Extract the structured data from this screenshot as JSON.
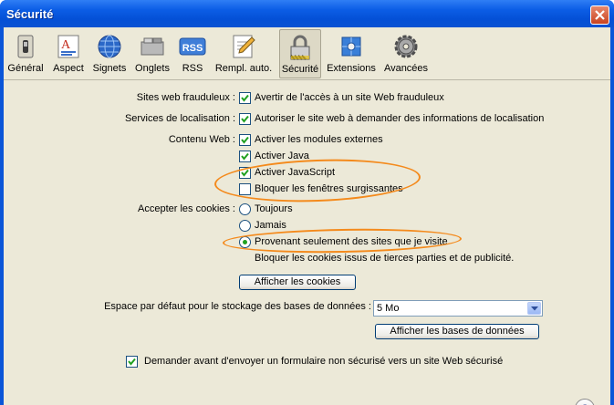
{
  "window": {
    "title": "Sécurité"
  },
  "toolbar": {
    "items": [
      {
        "label": "Général",
        "icon": "switch-icon"
      },
      {
        "label": "Aspect",
        "icon": "font-icon"
      },
      {
        "label": "Signets",
        "icon": "globe-icon"
      },
      {
        "label": "Onglets",
        "icon": "tabs-icon"
      },
      {
        "label": "RSS",
        "icon": "rss-icon"
      },
      {
        "label": "Rempl. auto.",
        "icon": "pencil-icon"
      },
      {
        "label": "Sécurité",
        "icon": "lock-icon",
        "selected": true
      },
      {
        "label": "Extensions",
        "icon": "puzzle-icon"
      },
      {
        "label": "Avancées",
        "icon": "gear-icon"
      }
    ]
  },
  "security": {
    "fraud_label": "Sites web frauduleux :",
    "fraud_option": "Avertir de l'accès à un site Web frauduleux",
    "location_label": "Services de localisation :",
    "location_option": "Autoriser le site web à demander des informations de localisation",
    "web_content_label": "Contenu Web :",
    "plugins_option": "Activer les modules externes",
    "java_option": "Activer Java",
    "javascript_option": "Activer JavaScript",
    "popups_option": "Bloquer les fenêtres surgissantes",
    "cookies_label": "Accepter les cookies :",
    "cookies_always": "Toujours",
    "cookies_never": "Jamais",
    "cookies_visited": "Provenant seulement des sites que je visite",
    "cookies_note": "Bloquer les cookies issus de tierces parties et de publicité.",
    "show_cookies_button": "Afficher les cookies",
    "storage_label": "Espace par défaut pour le stockage des bases de données :",
    "storage_value": "5 Mo",
    "show_databases_button": "Afficher les bases de données",
    "insecure_form_option": "Demander avant d'envoyer un formulaire non sécurisé vers un site Web sécurisé",
    "help_label": "?"
  },
  "colors": {
    "title_bar": "#0a55d8",
    "panel": "#ece9d8",
    "highlight": "#f48a1c"
  }
}
